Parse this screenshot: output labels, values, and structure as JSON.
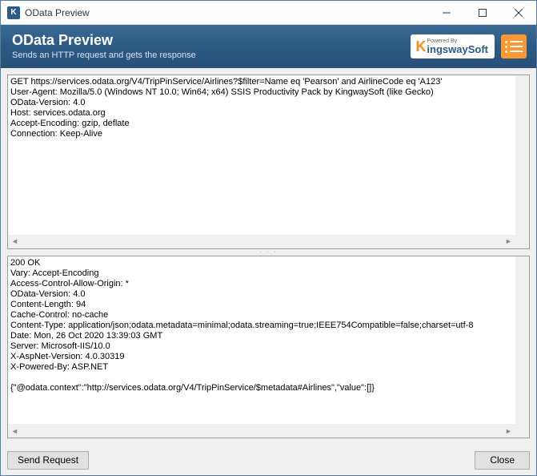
{
  "window": {
    "title": "OData Preview"
  },
  "banner": {
    "title": "OData Preview",
    "subtitle": "Sends an HTTP request and gets the response",
    "logo_powered": "Powered By",
    "logo_name": "ingswaySoft"
  },
  "request_text": "GET https://services.odata.org/V4/TripPinService/Airlines?$filter=Name eq 'Pearson' and AirlineCode eq 'A123'\nUser-Agent: Mozilla/5.0 (Windows NT 10.0; Win64; x64) SSIS Productivity Pack by KingwaySoft (like Gecko)\nOData-Version: 4.0\nHost: services.odata.org\nAccept-Encoding: gzip, deflate\nConnection: Keep-Alive",
  "response_text": "200 OK\nVary: Accept-Encoding\nAccess-Control-Allow-Origin: *\nOData-Version: 4.0\nContent-Length: 94\nCache-Control: no-cache\nContent-Type: application/json;odata.metadata=minimal;odata.streaming=true;IEEE754Compatible=false;charset=utf-8\nDate: Mon, 26 Oct 2020 13:39:03 GMT\nServer: Microsoft-IIS/10.0\nX-AspNet-Version: 4.0.30319\nX-Powered-By: ASP.NET\n\n{\"@odata.context\":\"http://services.odata.org/V4/TripPinService/$metadata#Airlines\",\"value\":[]}",
  "buttons": {
    "send": "Send Request",
    "close": "Close"
  }
}
